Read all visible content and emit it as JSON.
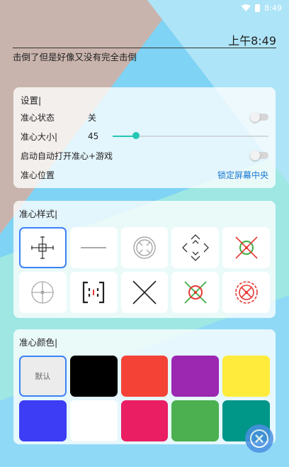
{
  "status_bar": {
    "time": "8:49"
  },
  "clock": {
    "time": "上午8:49"
  },
  "headline": "击倒了但是好像又没有完全击倒",
  "settings": {
    "title": "设置|",
    "rows": [
      {
        "label": "准心状态",
        "value": "关",
        "control": "toggle"
      },
      {
        "label": "准心大小|",
        "value": "45",
        "control": "slider",
        "level": 0.15
      },
      {
        "label": "启动自动打开准心+游戏",
        "control": "toggle"
      },
      {
        "label": "准心位置",
        "link": "锁定屏幕中央"
      }
    ]
  },
  "crosshair_styles": {
    "title": "准心样式|",
    "items": [
      {
        "icon": "crosshair-arrows-icon",
        "selected": true
      },
      {
        "icon": "horizontal-line-icon"
      },
      {
        "icon": "circle-x-icon"
      },
      {
        "icon": "diamond-corners-icon"
      },
      {
        "icon": "red-x-green-circle-icon"
      },
      {
        "icon": "circle-cross-icon"
      },
      {
        "icon": "bracket-box-icon"
      },
      {
        "icon": "big-x-icon"
      },
      {
        "icon": "green-circle-red-x-icon"
      },
      {
        "icon": "red-gear-icon"
      }
    ]
  },
  "crosshair_colors": {
    "title": "准心颜色|",
    "default_label": "默认",
    "swatches": [
      "#000000",
      "#f44336",
      "#9c27b0",
      "#ffeb3b",
      "#3d3df5",
      "#ffffff",
      "#e91e63",
      "#4caf50",
      "#009688"
    ]
  },
  "colors": {
    "accent": "#3b82f6",
    "slider": "#26c6b5",
    "link": "#1976d2"
  }
}
